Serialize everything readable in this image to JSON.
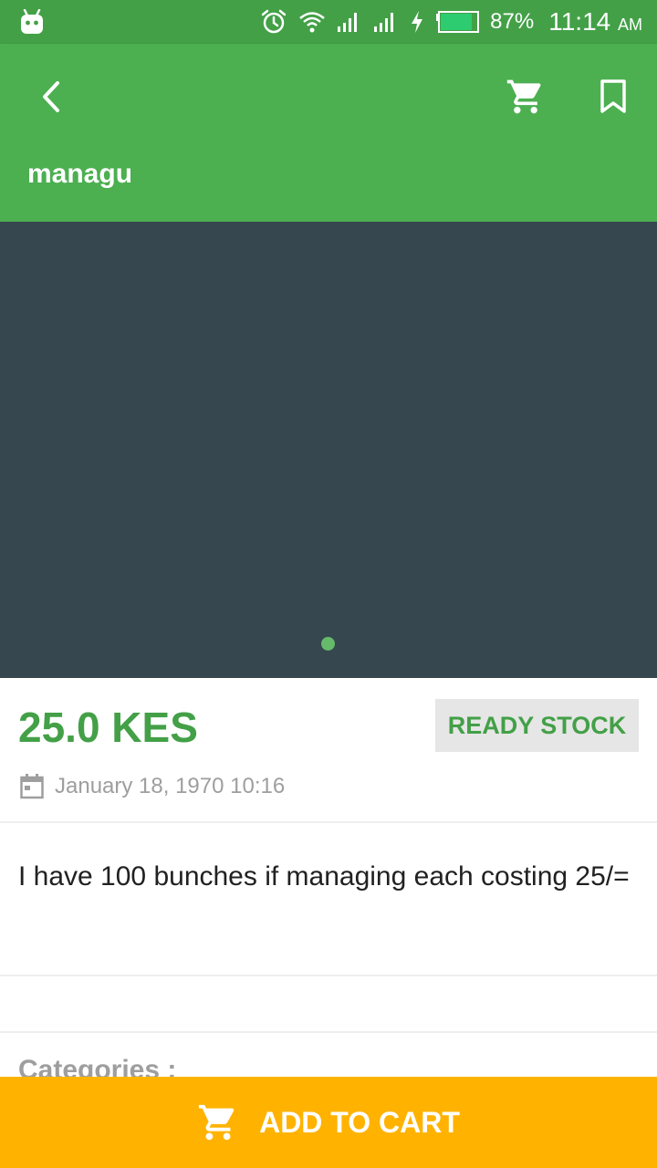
{
  "status_bar": {
    "battery_percent": "87%",
    "time": "11:14",
    "ampm": "AM",
    "icons": [
      "android-icon",
      "alarm-icon",
      "wifi-icon",
      "signal-icon",
      "signal-icon",
      "charging-icon",
      "battery-icon"
    ],
    "battery_level": 0.87,
    "battery_color": "#2ECC71"
  },
  "app_bar": {
    "title": "managu",
    "background": "#4CAF50",
    "icons": [
      "back-arrow-icon",
      "cart-icon",
      "bookmark-icon"
    ]
  },
  "gallery": {
    "background": "#37474F",
    "indicator_color": "#66BB6A",
    "page_count": 1,
    "current_page": 1
  },
  "product": {
    "price": "25.0 KES",
    "stock_status": "READY STOCK",
    "date": "January 18, 1970 10:16",
    "description": "I have 100 bunches if managing each costing 25/=",
    "categories_label": "Categories :"
  },
  "footer": {
    "add_to_cart_label": "ADD TO CART",
    "background": "#FFB300"
  },
  "colors": {
    "primary": "#4CAF50",
    "primary_dark": "#43A047",
    "accent": "#FFB300"
  }
}
